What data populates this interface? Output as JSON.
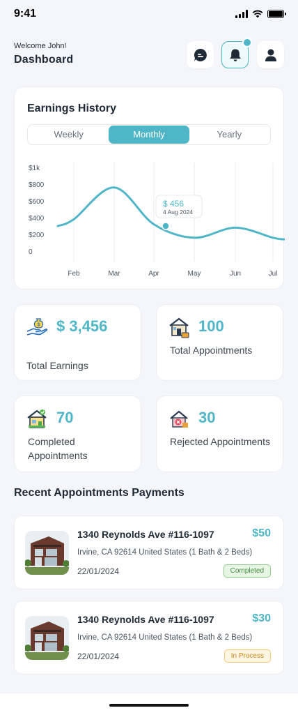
{
  "status": {
    "time": "9:41"
  },
  "header": {
    "welcome": "Welcome John!",
    "title": "Dashboard",
    "icons": [
      "chat-icon",
      "bell-icon",
      "user-icon"
    ]
  },
  "earnings": {
    "title": "Earnings History",
    "tabs": [
      "Weekly",
      "Monthly",
      "Yearly"
    ],
    "active_tab": "Monthly",
    "tooltip": {
      "value": "$ 456",
      "date": "4 Aug 2024"
    }
  },
  "chart_data": {
    "type": "line",
    "x": [
      "Feb",
      "Mar",
      "Apr",
      "May",
      "Jun",
      "Jul"
    ],
    "series": [
      {
        "values": [
          380,
          760,
          320,
          160,
          280,
          160
        ]
      }
    ],
    "y_ticks": [
      "$1k",
      "$800",
      "$600",
      "$400",
      "$200",
      "0"
    ],
    "ylim": [
      0,
      1000
    ],
    "grid": "vertical",
    "color": "#4fb6c7"
  },
  "stats": [
    {
      "value": "$ 3,456",
      "label": "Total Earnings",
      "icon": "money-hand-icon"
    },
    {
      "value": "100",
      "label": "Total Appointments",
      "icon": "house-appointment-icon"
    },
    {
      "value": "70",
      "label": "Completed Appointments",
      "icon": "house-check-icon"
    },
    {
      "value": "30",
      "label": "Rejected Appointments",
      "icon": "house-reject-icon"
    }
  ],
  "recent": {
    "title": "Recent Appointments Payments",
    "items": [
      {
        "address": "1340 Reynolds Ave #116-1097",
        "price": "$50",
        "city": "Irvine, CA 92614 United States (1 Bath & 2 Beds)",
        "date": "22/01/2024",
        "status": "Completed"
      },
      {
        "address": "1340 Reynolds Ave #116-1097",
        "price": "$30",
        "city": "Irvine, CA 92614 United States (1 Bath & 2 Beds)",
        "date": "22/01/2024",
        "status": "In Process"
      }
    ]
  },
  "colors": {
    "accent": "#4fb6c7",
    "completed": "#4a8f45",
    "in_process": "#c78a1b"
  }
}
